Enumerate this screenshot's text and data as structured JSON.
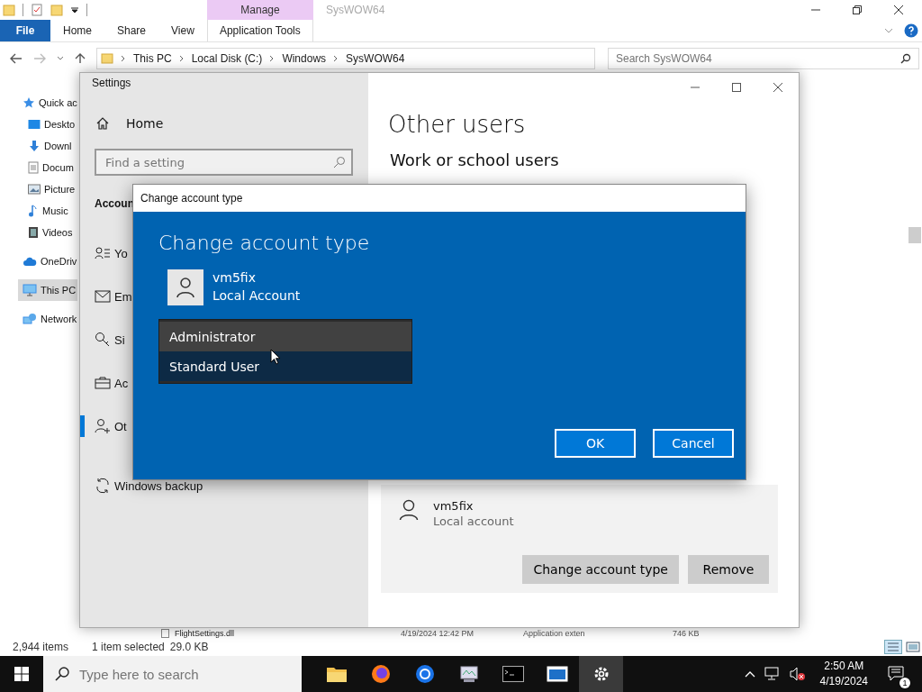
{
  "explorer": {
    "context_header": "Manage",
    "title": "SysWOW64",
    "ribbon_tabs": [
      {
        "label": "File",
        "kind": "file"
      },
      {
        "label": "Home",
        "kind": "plain"
      },
      {
        "label": "Share",
        "kind": "plain"
      },
      {
        "label": "View",
        "kind": "plain"
      },
      {
        "label": "Application Tools",
        "kind": "context"
      }
    ],
    "address_path": [
      "This PC",
      "Local Disk (C:)",
      "Windows",
      "SysWOW64"
    ],
    "search": {
      "placeholder": "Search SysWOW64"
    },
    "nav_items": [
      {
        "label": "Quick ac",
        "selected": false,
        "children": [
          {
            "label": "Deskto",
            "selected": false
          },
          {
            "label": "Downl",
            "selected": false
          },
          {
            "label": "Docum",
            "selected": false
          },
          {
            "label": "Picture",
            "selected": false
          },
          {
            "label": "Music",
            "selected": false
          },
          {
            "label": "Videos",
            "selected": false
          }
        ]
      },
      {
        "label": "OneDriv",
        "selected": false
      },
      {
        "label": "This PC",
        "selected": true
      },
      {
        "label": "Network",
        "selected": false
      }
    ],
    "file_row": [
      "FlightSettings.dll",
      "4/19/2024 12:42 PM",
      "Application exten",
      "746 KB"
    ],
    "status_bar": {
      "item_count": "2,944 items",
      "selection": "1 item selected",
      "size": "29.0 KB"
    }
  },
  "settings": {
    "title": "Settings",
    "home": "Home",
    "search": {
      "placeholder": "Find a setting"
    },
    "section": "Accoun",
    "nav": [
      {
        "label": "Yo",
        "selected": false
      },
      {
        "label": "Em",
        "selected": false
      },
      {
        "label": "Si",
        "selected": false
      },
      {
        "label": "Ac",
        "selected": false
      },
      {
        "label": "Ot",
        "selected": true
      },
      {
        "label": "Windows backup",
        "selected": false
      }
    ],
    "page_title": "Other users",
    "subheading": "Work or school users",
    "user_card": {
      "name": "vm5fix",
      "type": "Local account"
    },
    "buttons": [
      "Change account type",
      "Remove"
    ]
  },
  "dialog": {
    "title": "Change account type",
    "heading": "Change account type",
    "account": {
      "name": "vm5fix",
      "type": "Local Account"
    },
    "options": [
      {
        "label": "Administrator",
        "selected": false,
        "hovered": true
      },
      {
        "label": "Standard User",
        "selected": true,
        "hovered": false
      }
    ],
    "buttons": [
      "OK",
      "Cancel"
    ]
  },
  "taskbar": {
    "search_placeholder": "Type here to search",
    "apps": [
      {
        "active": false
      },
      {
        "active": false
      },
      {
        "active": false
      },
      {
        "active": false
      },
      {
        "active": false
      },
      {
        "active": false
      },
      {
        "active": true
      }
    ],
    "time": "2:50 AM",
    "date": "4/19/2024",
    "notification_count": "1"
  }
}
